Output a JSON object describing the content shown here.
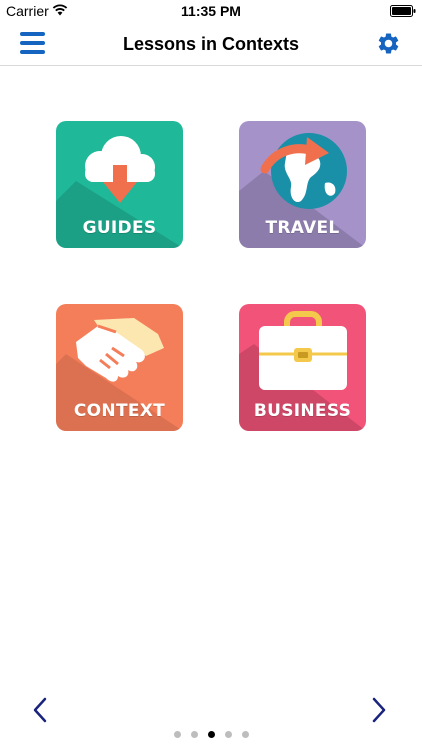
{
  "status_bar": {
    "carrier": "Carrier",
    "time": "11:35 PM"
  },
  "nav": {
    "title": "Lessons in Contexts",
    "menu_icon": "hamburger-menu-icon",
    "settings_icon": "gear-icon"
  },
  "tiles": [
    {
      "label": "GUIDES",
      "icon": "cloud-download-icon",
      "color": "#1fb899"
    },
    {
      "label": "TRAVEL",
      "icon": "globe-plane-icon",
      "color": "#a592c9"
    },
    {
      "label": "CONTEXT",
      "icon": "handshake-icon",
      "color": "#f47e5a"
    },
    {
      "label": "BUSINESS",
      "icon": "briefcase-icon",
      "color": "#f25479"
    }
  ],
  "pager": {
    "total_pages": 5,
    "current_page": 3,
    "prev_icon": "chevron-left-icon",
    "next_icon": "chevron-right-icon"
  },
  "colors": {
    "accent": "#1565c0",
    "dot_inactive": "#bdbdbd",
    "dot_active": "#000000"
  }
}
